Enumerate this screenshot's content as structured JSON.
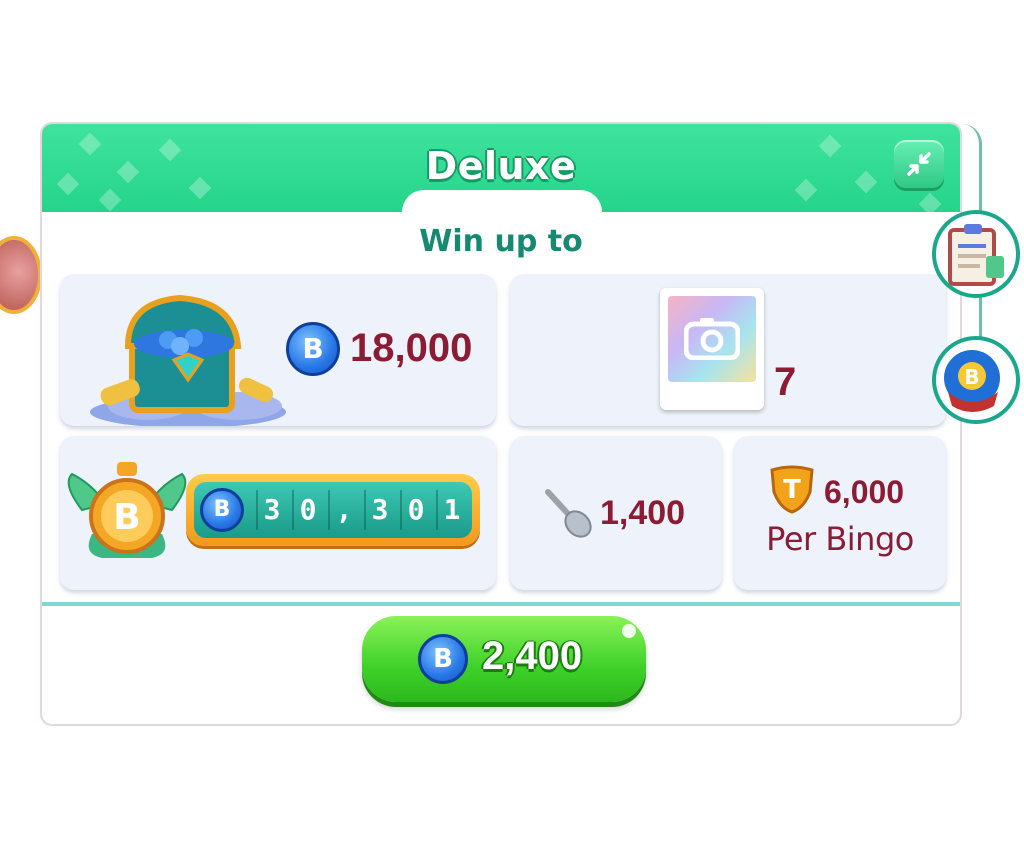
{
  "header": {
    "title": "Deluxe",
    "collapse_icon": "collapse-arrows-icon"
  },
  "subtitle": "Win up to",
  "rewards": {
    "chest": {
      "icon": "treasure-chest-icon",
      "currency_icon": "bingo-coin-icon",
      "value": "18,000"
    },
    "photo": {
      "icon": "camera-photo-card-icon",
      "value": "7"
    },
    "counter": {
      "badge_icon": "winged-b-medal-icon",
      "coin_icon": "bingo-coin-icon",
      "digits": [
        "3",
        "0",
        ",",
        "3",
        "0",
        "1"
      ]
    },
    "spoon": {
      "icon": "spoon-icon",
      "value": "1,400"
    },
    "token": {
      "icon": "t-shield-token-icon",
      "value": "6,000",
      "caption": "Per Bingo"
    }
  },
  "buy_button": {
    "coin_icon": "bingo-coin-icon",
    "label": "2,400"
  },
  "side_icons": [
    "clipboard-icon",
    "bingo-ball-icon"
  ],
  "colors": {
    "header_green": "#2fd88f",
    "value_maroon": "#8c1b34",
    "subtitle_teal": "#168a70",
    "button_green": "#3ed12a",
    "coin_blue": "#2777e6"
  }
}
